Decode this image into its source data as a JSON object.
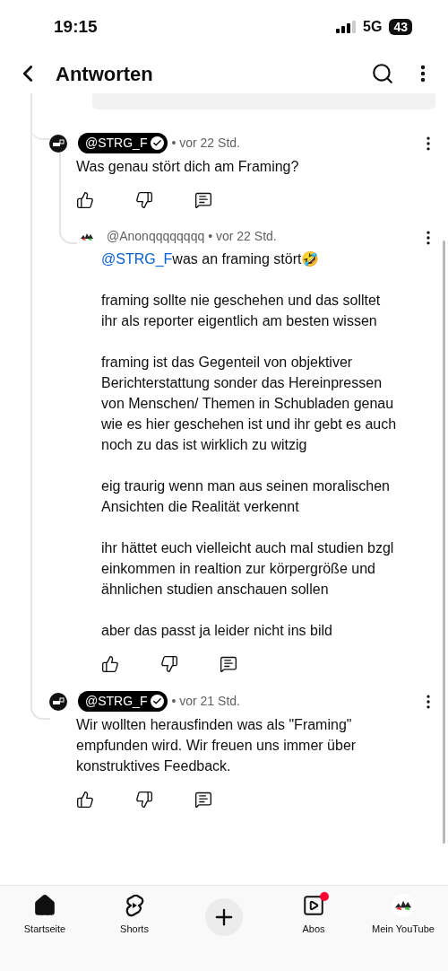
{
  "status_bar": {
    "time": "19:15",
    "network": "5G",
    "battery": "43"
  },
  "header": {
    "title": "Antworten"
  },
  "comments": [
    {
      "author": "@STRG_F",
      "highlighted": true,
      "verified": true,
      "time": "• vor 22 Std.",
      "paragraphs": [
        "Was genau stört dich am Framing?"
      ],
      "children": [
        {
          "author": "@Anonqqqqqqqq",
          "highlighted": false,
          "time": "• vor 22 Std.",
          "mention": "@STRG_F",
          "paragraphs": [
            "was an framing stört🤣",
            "framing sollte nie geschehen und das solltet ihr als reporter eigentlich am besten wissen",
            "framing ist das Gegenteil von objektiver Berichterstattung sonder das Hereinpressen von Menschen/ Themen in Schubladen genau wie es hier geschehen ist und ihr gebt es auch noch zu das ist wirklich zu witzig",
            "eig traurig wenn man aus seinen moralischen Ansichten die Realität verkennt",
            "ihr hättet euch vielleicht auch mal studien bzgl einkommen in realtion zur körpergröße und ähnlichen studien anschauen sollen",
            "aber das passt ja leider nicht ins bild"
          ]
        }
      ]
    },
    {
      "author": "@STRG_F",
      "highlighted": true,
      "verified": true,
      "time": "• vor 21 Std.",
      "paragraphs": [
        "Wir wollten herausfinden was als \"Framing\" empfunden wird. Wir freuen uns immer über konstruktives Feedback."
      ]
    }
  ],
  "nav": [
    {
      "kind": "home",
      "label": "Startseite",
      "notification": false
    },
    {
      "kind": "shorts",
      "label": "Shorts",
      "notification": false
    },
    {
      "kind": "create"
    },
    {
      "kind": "subscriptions",
      "label": "Abos",
      "notification": true
    },
    {
      "kind": "avatar",
      "label": "Mein YouTube",
      "notification": false
    }
  ]
}
